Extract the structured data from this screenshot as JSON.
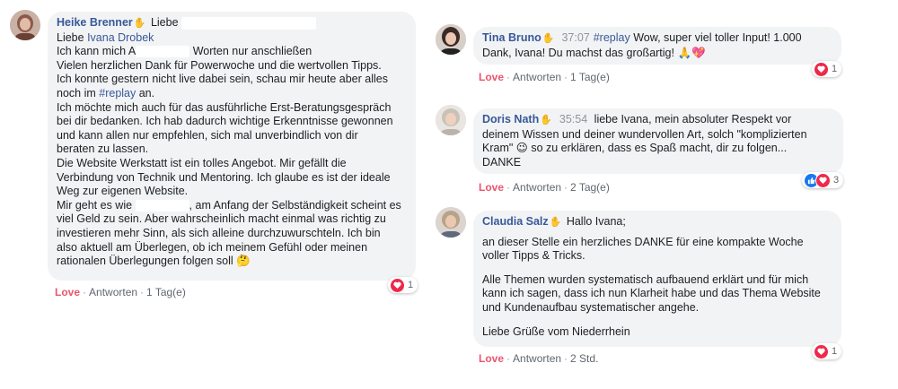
{
  "comments": [
    {
      "id": "heike",
      "name": "Heike Brenner",
      "wave_icon": "waving-hand-icon",
      "text_lines": [
        "Liebe",
        "Liebe Ivana Drobek",
        "Ich kann mich A",
        "Worten nur anschließen",
        "Vielen herzlichen Dank für Powerwoche und die wertvollen Tipps.",
        "Ich konnte gestern nicht live dabei sein, schau mir heute aber alles",
        "noch im #replay an.",
        "Ich möchte mich auch für das ausführliche Erst-Beratungsgespräch",
        "bei dir bedanken. Ich hab dadurch wichtige Erkenntnisse gewonnen",
        "und kann allen nur empfehlen, sich mal unverbindlich von dir",
        "beraten zu lassen.",
        "Die Website Werkstatt ist ein tolles Angebot. Mir gefällt die",
        "Verbindung von Technik und Mentoring. Ich glaube es ist der ideale",
        "Weg zur eigenen Website.",
        "Mir geht es wie",
        ", am Anfang der Selbständigkeit scheint es",
        "viel Geld zu sein. Aber wahrscheinlich macht einmal was richtig zu",
        "investieren mehr Sinn, als sich alleine durchzuwurschteln. Ich bin",
        "also aktuell am Überlegen, ob ich meinem Gefühl oder meinen",
        "rationalen Überlegungen folgen soll"
      ],
      "mention": "Ivana Drobek",
      "hashtag": "#replay",
      "emoji": "🤔",
      "actions": {
        "love": "Love",
        "reply": "Antworten",
        "time": "1 Tag(e)"
      },
      "reactions": {
        "count": "1",
        "types": [
          "love"
        ]
      }
    },
    {
      "id": "tina",
      "name": "Tina Bruno",
      "wave_icon": "waving-hand-icon",
      "timestamp": "37:07",
      "hashtag": "#replay",
      "text_lines": [
        "Wow, super viel toller Input! 1.000",
        "Dank, Ivana! Du machst das großartig!"
      ],
      "emoji": "🙏💖",
      "actions": {
        "love": "Love",
        "reply": "Antworten",
        "time": "1 Tag(e)"
      },
      "reactions": {
        "count": "1",
        "types": [
          "love"
        ]
      }
    },
    {
      "id": "doris",
      "name": "Doris Nath",
      "wave_icon": "waving-hand-icon",
      "timestamp": "35:54",
      "text_lines": [
        "liebe Ivana, mein absoluter Respekt vor",
        "deinem Wissen und deiner wundervollen Art, solch \"komplizierten",
        "Kram\"",
        "so zu erklären, dass es Spaß macht, dir zu folgen...",
        "DANKE"
      ],
      "emoji": "😉",
      "actions": {
        "love": "Love",
        "reply": "Antworten",
        "time": "2 Tag(e)"
      },
      "reactions": {
        "count": "3",
        "types": [
          "like",
          "love"
        ]
      }
    },
    {
      "id": "claudia",
      "name": "Claudia Salz",
      "wave_icon": "waving-hand-icon",
      "text_lines": [
        "Hallo Ivana;",
        "an dieser Stelle ein herzliches DANKE für eine kompakte Woche",
        "voller Tipps & Tricks.",
        "Alle Themen wurden systematisch aufbauend erklärt und für mich",
        "kann ich sagen, dass ich nun Klarheit habe und das Thema Website",
        "und Kundenaufbau systematischer angehe.",
        "Liebe Grüße vom Niederrhein"
      ],
      "actions": {
        "love": "Love",
        "reply": "Antworten",
        "time": "2 Std."
      },
      "reactions": {
        "count": "1",
        "types": [
          "love"
        ]
      }
    }
  ],
  "colors": {
    "name": "#385898",
    "love": "#e9566d",
    "bubble": "#f2f3f5"
  }
}
